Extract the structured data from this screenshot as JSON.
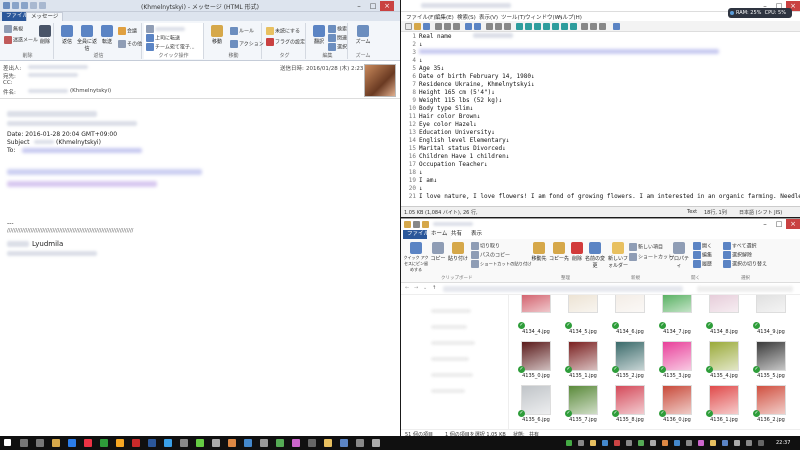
{
  "outlook": {
    "title": "(Khmelnytskyi) - メッセージ (HTML 形式)",
    "tabs": [
      "ファイル",
      "メッセージ"
    ],
    "ribbon": {
      "delete_group": {
        "ignore": "無視",
        "junk": "迷惑メール",
        "delete": "削除",
        "label": "削除"
      },
      "respond_group": {
        "reply": "返信",
        "reply_all": "全員に返信",
        "forward": "転送",
        "meeting": "会議",
        "more": "その他",
        "label": "返信"
      },
      "quick_group": {
        "to_manager": "上司に転送",
        "team": "チーム宛て電子...",
        "done": "完了",
        "label": "クイック操作"
      },
      "move_group": {
        "move": "移動",
        "rules": "ルール",
        "actions": "アクション",
        "label": "移動"
      },
      "tags_group": {
        "unread": "未読にする",
        "categorize": "分類",
        "followup": "フラグの設定",
        "label": "タグ"
      },
      "edit_group": {
        "translate": "翻訳",
        "search": "検索",
        "related": "関連",
        "select": "選択",
        "label": "編集"
      },
      "zoom_group": {
        "zoom": "ズーム",
        "label": "ズーム"
      }
    },
    "header": {
      "from_label": "差出人:",
      "to_label": "宛先:",
      "cc_label": "CC:",
      "subject_label": "件名:",
      "subject_value": "(Khmelnytskyi)",
      "sent_label": "送信日時:",
      "sent_value": "2016/01/28 (木) 2:23"
    },
    "body": {
      "date_line": "Date: 2016-01-28 20:04 GMT+09:00",
      "subject_label": "Subject",
      "subject_value": "(Khmelnytskyi)",
      "to_label": "To:",
      "separator": "---",
      "slashes": "///////////////////////////////////////////////////////////////////////////",
      "signature": "Lyudmila"
    }
  },
  "editor": {
    "menu": [
      "ファイル(F)",
      "編集(E)",
      "検索(S)",
      "表示(V)",
      "ツール(T)",
      "ウィンドウ(W)",
      "ヘルプ(H)"
    ],
    "lines": [
      {
        "n": "1",
        "t": "Real name"
      },
      {
        "n": "2",
        "t": "↓"
      },
      {
        "n": "3",
        "t": ""
      },
      {
        "n": "4",
        "t": "↓"
      },
      {
        "n": "5",
        "t": "Age     35↓"
      },
      {
        "n": "6",
        "t": "Date of birth  February 14, 1980↓"
      },
      {
        "n": "7",
        "t": "Residence      Ukraine, Khmelnytskyi↓"
      },
      {
        "n": "8",
        "t": "Height  165 cm (5'4\")↓"
      },
      {
        "n": "9",
        "t": "Weight  115 lbs (52 kg)↓"
      },
      {
        "n": "10",
        "t": "Body type      Slim↓"
      },
      {
        "n": "11",
        "t": "Hair color     Brown↓"
      },
      {
        "n": "12",
        "t": "Eye color      Hazel↓"
      },
      {
        "n": "13",
        "t": "Education      University↓"
      },
      {
        "n": "14",
        "t": "English level  Elementary↓"
      },
      {
        "n": "15",
        "t": "Marital status Divorced↓"
      },
      {
        "n": "16",
        "t": "Children       Have 1 children↓"
      },
      {
        "n": "17",
        "t": "Occupation     Teacher↓"
      },
      {
        "n": "18",
        "t": "↓"
      },
      {
        "n": "19",
        "t": "I am↓"
      },
      {
        "n": "20",
        "t": "↓"
      },
      {
        "n": "21",
        "t": "I love nature, I love flowers! I am fond of growing flowers. I am interested in an organic farming. Needlework i"
      }
    ],
    "status_left": "1.05 KB (1,084 バイト), 26 行,",
    "status_text": "Text",
    "status_pos": "18行, 1列",
    "status_enc": "日本語 (シフト JIS)",
    "ram": "RAM: 25%",
    "cpu": "CPU: 5%"
  },
  "explorer": {
    "tabs": [
      "ファイル",
      "ホーム",
      "共有",
      "表示"
    ],
    "ribbon": {
      "quick_access": "クイック アクセスにピン留めする",
      "copy": "コピー",
      "paste": "貼り付け",
      "cut": "切り取り",
      "copy_path": "パスのコピー",
      "paste_shortcut": "ショートカットの貼り付け",
      "clipboard_label": "クリップボード",
      "move_to": "移動先",
      "copy_to": "コピー先",
      "delete": "削除",
      "rename": "名前の変更",
      "organize_label": "整理",
      "new_folder": "新しいフォルダー",
      "new_item": "新しい項目",
      "shortcut": "ショートカット",
      "new_label": "新規",
      "properties": "プロパティ",
      "open": "開く",
      "edit": "編集",
      "history": "履歴",
      "open_label": "開く",
      "select_all": "すべて選択",
      "select_none": "選択解除",
      "invert": "選択の切り替え",
      "select_label": "選択"
    },
    "files_row1": [
      "4134_4.jpg",
      "4134_5.jpg",
      "4134_6.jpg",
      "4134_7.jpg",
      "4134_8.jpg",
      "4134_9.jpg"
    ],
    "files_row2": [
      "4135_0.jpg",
      "4135_1.jpg",
      "4135_2.jpg",
      "4135_3.jpg",
      "4135_4.jpg",
      "4135_5.jpg"
    ],
    "files_row3": [
      "4135_6.jpg",
      "4135_7.jpg",
      "4135_8.jpg",
      "4136_0.jpg",
      "4136_1.jpg",
      "4136_2.jpg"
    ],
    "status_count": "51 個の項目",
    "status_selected": "1 個の項目を選択  1.05 KB",
    "status_state": "状態:",
    "status_share": "共有"
  },
  "taskbar": {
    "time": "22:37"
  }
}
